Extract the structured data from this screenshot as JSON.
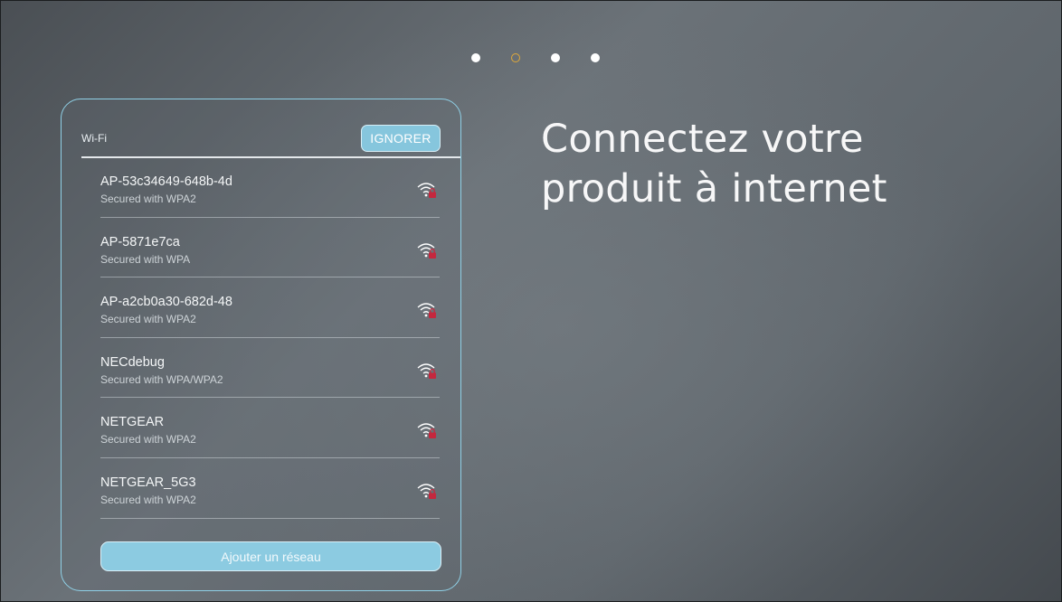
{
  "pager": {
    "count": 4,
    "active_index": 1
  },
  "panel": {
    "title": "Wi-Fi",
    "ignore_label": "IGNORER",
    "add_network_label": "Ajouter un réseau"
  },
  "networks": [
    {
      "name": "AP-53c34649-648b-4d",
      "security": "Secured with WPA2",
      "icon": "wifi-locked-icon"
    },
    {
      "name": "AP-5871e7ca",
      "security": "Secured with WPA",
      "icon": "wifi-locked-icon"
    },
    {
      "name": "AP-a2cb0a30-682d-48",
      "security": "Secured with WPA2",
      "icon": "wifi-locked-icon"
    },
    {
      "name": "NECdebug",
      "security": "Secured with WPA/WPA2",
      "icon": "wifi-locked-icon"
    },
    {
      "name": "NETGEAR",
      "security": "Secured with WPA2",
      "icon": "wifi-locked-icon"
    },
    {
      "name": "NETGEAR_5G3",
      "security": "Secured with WPA2",
      "icon": "wifi-locked-icon"
    }
  ],
  "headline": {
    "line1": "Connectez votre",
    "line2": "produit à internet"
  },
  "colors": {
    "accent": "#86c6dd",
    "panel_border": "#8fd0e6",
    "active_dot": "#e0a93a",
    "lock": "#c4283e"
  }
}
